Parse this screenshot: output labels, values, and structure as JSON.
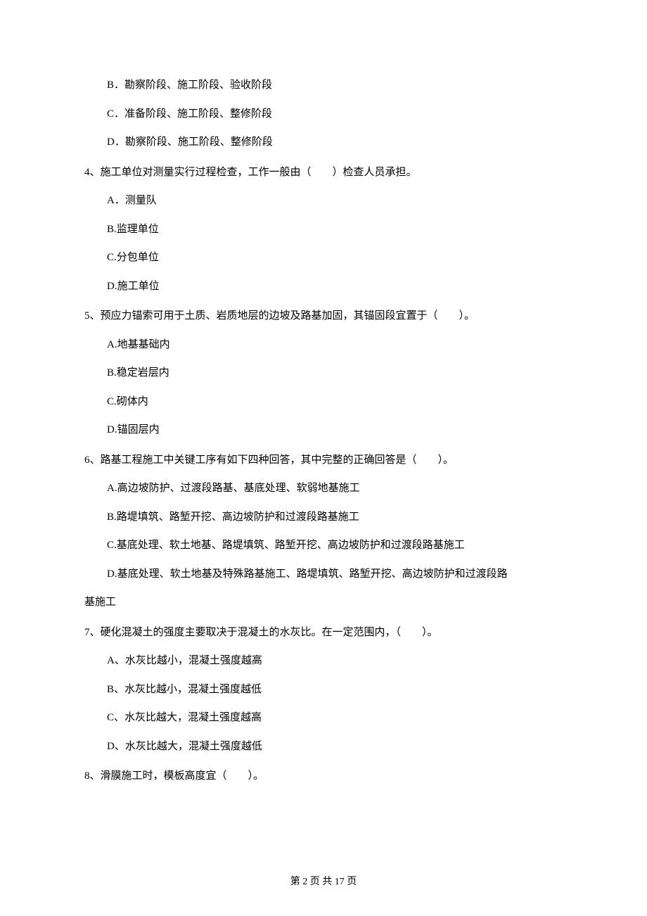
{
  "orphan_options": {
    "b": "B．勘察阶段、施工阶段、验收阶段",
    "c": "C．准备阶段、施工阶段、整修阶段",
    "d": "D．勘察阶段、施工阶段、整修阶段"
  },
  "q4": {
    "text": "4、施工单位对测量实行过程检查，工作一般由（　　）检查人员承担。",
    "a": "A．测量队",
    "b": "B.监理单位",
    "c": "C.分包单位",
    "d": "D.施工单位"
  },
  "q5": {
    "text": "5、预应力锚索可用于土质、岩质地层的边坡及路基加固，其锚固段宜置于（　　）。",
    "a": "A.地基基础内",
    "b": "B.稳定岩层内",
    "c": "C.砌体内",
    "d": "D.锚固层内"
  },
  "q6": {
    "text": "6、路基工程施工中关键工序有如下四种回答，其中完整的正确回答是（　　）。",
    "a": "A.高边坡防护、过渡段路基、基底处理、软弱地基施工",
    "b": "B.路堤填筑、路堑开挖、高边坡防护和过渡段路基施工",
    "c": "C.基底处理、软土地基、路堤填筑、路堑开挖、高边坡防护和过渡段路基施工",
    "d_line1": "D.基底处理、软土地基及特殊路基施工、路堤填筑、路堑开挖、高边坡防护和过渡段路",
    "d_line2": "基施工"
  },
  "q7": {
    "text": "7、硬化混凝土的强度主要取决于混凝土的水灰比。在一定范围内，（　　）。",
    "a": "A、水灰比越小，混凝土强度越高",
    "b": "B、水灰比越小，混凝土强度越低",
    "c": "C、水灰比越大，混凝土强度越高",
    "d": "D、水灰比越大，混凝土强度越低"
  },
  "q8": {
    "text": "8、滑膜施工时，模板高度宜（　　）。"
  },
  "footer": "第 2 页 共 17 页"
}
